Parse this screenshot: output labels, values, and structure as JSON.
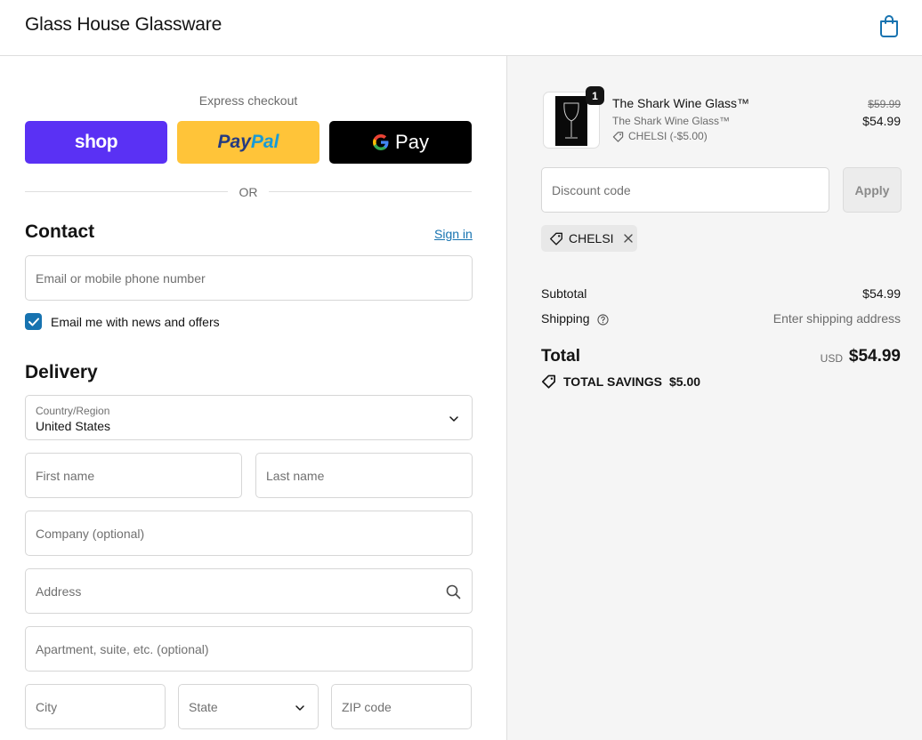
{
  "header": {
    "store_name": "Glass House Glassware",
    "cart_icon": "shopping-bag-icon"
  },
  "express": {
    "label": "Express checkout",
    "shop_label": "shop",
    "paypal_part1": "Pay",
    "paypal_part2": "Pal",
    "gpay_g": "G",
    "gpay_label": "Pay",
    "or_label": "OR",
    "colors": {
      "shop": "#5a31f4",
      "paypal": "#ffc439",
      "gpay": "#000000"
    }
  },
  "contact": {
    "title": "Contact",
    "sign_in": "Sign in",
    "email_placeholder": "Email or mobile phone number",
    "newsletter_label": "Email me with news and offers",
    "newsletter_checked": true
  },
  "delivery": {
    "title": "Delivery",
    "country_label": "Country/Region",
    "country_value": "United States",
    "first_name_placeholder": "First name",
    "last_name_placeholder": "Last name",
    "company_placeholder": "Company (optional)",
    "address_placeholder": "Address",
    "apartment_placeholder": "Apartment, suite, etc. (optional)",
    "city_placeholder": "City",
    "state_placeholder": "State",
    "zip_placeholder": "ZIP code"
  },
  "summary": {
    "item": {
      "name": "The Shark Wine Glass™",
      "variant": "The Shark Wine Glass™",
      "discount": "CHELSI (-$5.00)",
      "quantity": "1",
      "price_original": "$59.99",
      "price": "$54.99"
    },
    "discount_placeholder": "Discount code",
    "apply_label": "Apply",
    "applied_code": "CHELSI",
    "subtotal_label": "Subtotal",
    "subtotal_value": "$54.99",
    "shipping_label": "Shipping",
    "shipping_value": "Enter shipping address",
    "total_label": "Total",
    "currency": "USD",
    "total_value": "$54.99",
    "savings_label": "TOTAL SAVINGS",
    "savings_value": "$5.00"
  }
}
